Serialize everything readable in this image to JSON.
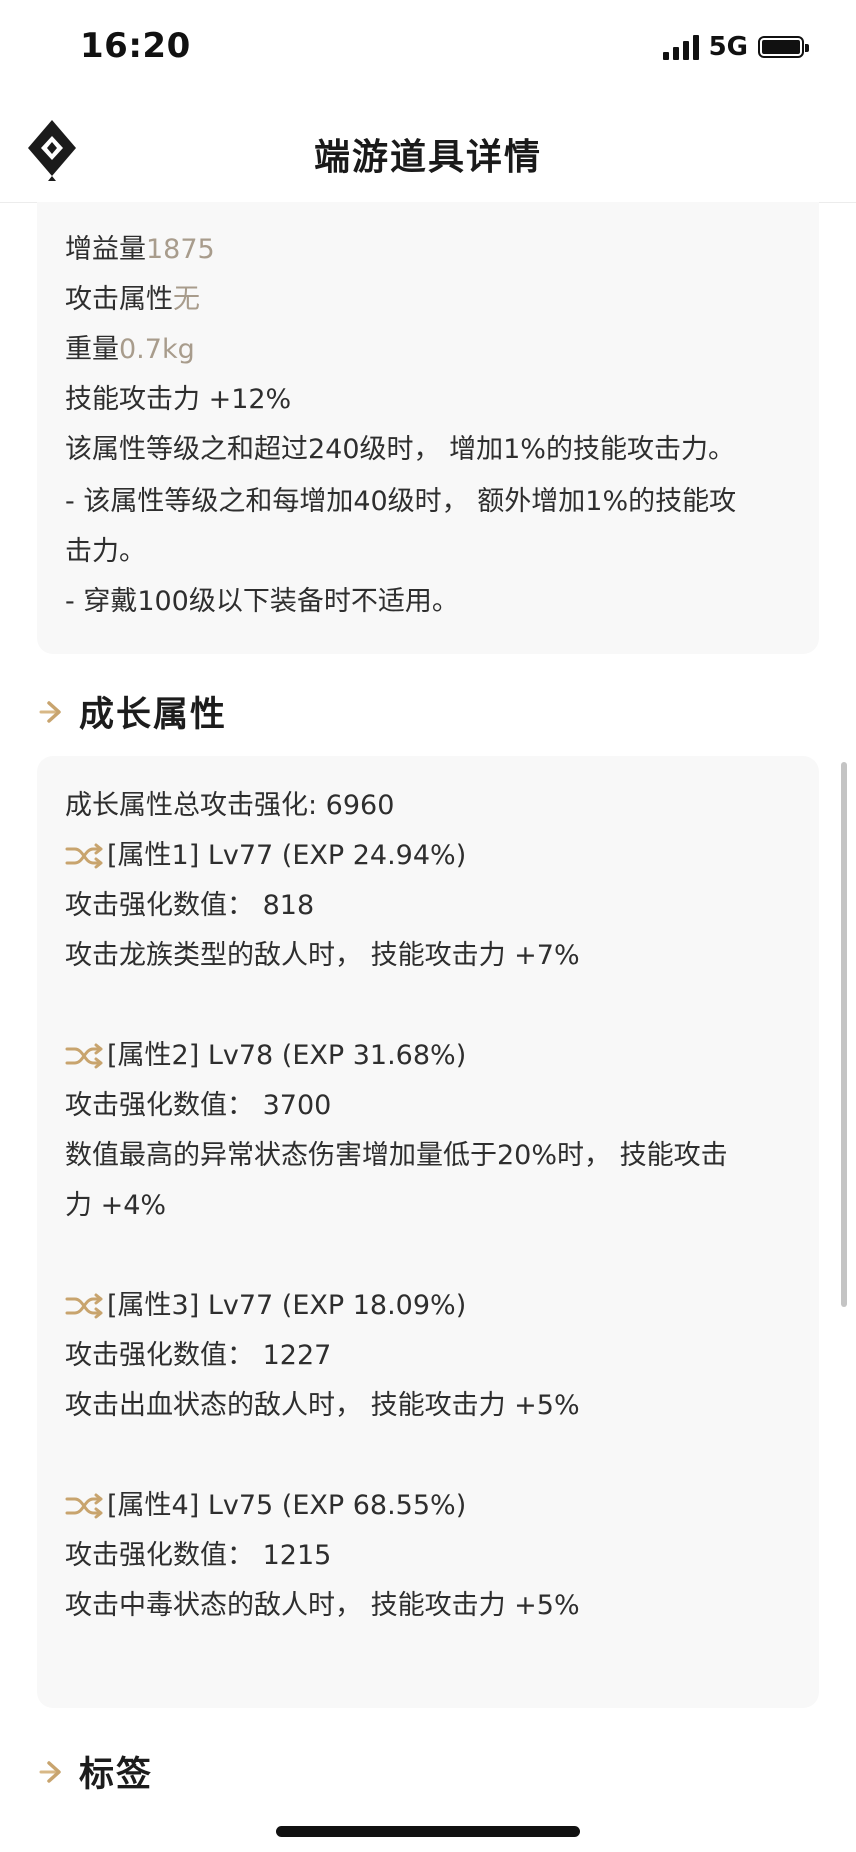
{
  "status_bar": {
    "time": "16:20",
    "network": "5G"
  },
  "nav": {
    "title": "端游道具详情",
    "logo_icon": "diamond-logo-icon"
  },
  "details": {
    "gain_label": "增益量",
    "gain_value": "1875",
    "attack_attr_label": "攻击属性",
    "attack_attr_value": "无",
    "weight_label": "重量",
    "weight_value": "0.7kg",
    "skill_attack": "技能攻击力 +12%",
    "desc1": "该属性等级之和超过240级时， 增加1%的技能攻击力。",
    "desc2a": "- 该属性等级之和每增加40级时， 额外增加1%的技能攻",
    "desc2b": "击力。",
    "desc3": "- 穿戴100级以下装备时不适用。"
  },
  "growth": {
    "section_title": "成长属性",
    "total": "成长属性总攻击强化: 6960",
    "attrs": [
      {
        "head": "[属性1] Lv77 (EXP 24.94%)",
        "value": "攻击强化数值： 818",
        "effect": "攻击龙族类型的敌人时， 技能攻击力 +7%",
        "effect2": ""
      },
      {
        "head": "[属性2] Lv78 (EXP 31.68%)",
        "value": "攻击强化数值： 3700",
        "effect": "数值最高的异常状态伤害增加量低于20%时， 技能攻击",
        "effect2": "力 +4%"
      },
      {
        "head": "[属性3] Lv77 (EXP 18.09%)",
        "value": "攻击强化数值： 1227",
        "effect": "攻击出血状态的敌人时， 技能攻击力 +5%",
        "effect2": ""
      },
      {
        "head": "[属性4] Lv75 (EXP 68.55%)",
        "value": "攻击强化数值： 1215",
        "effect": "攻击中毒状态的敌人时， 技能攻击力 +5%",
        "effect2": ""
      }
    ]
  },
  "tags": {
    "section_title": "标签"
  },
  "colors": {
    "accent": "#c8a46e",
    "muted_text": "#a89c8c",
    "card_bg": "#f8f8f8"
  }
}
